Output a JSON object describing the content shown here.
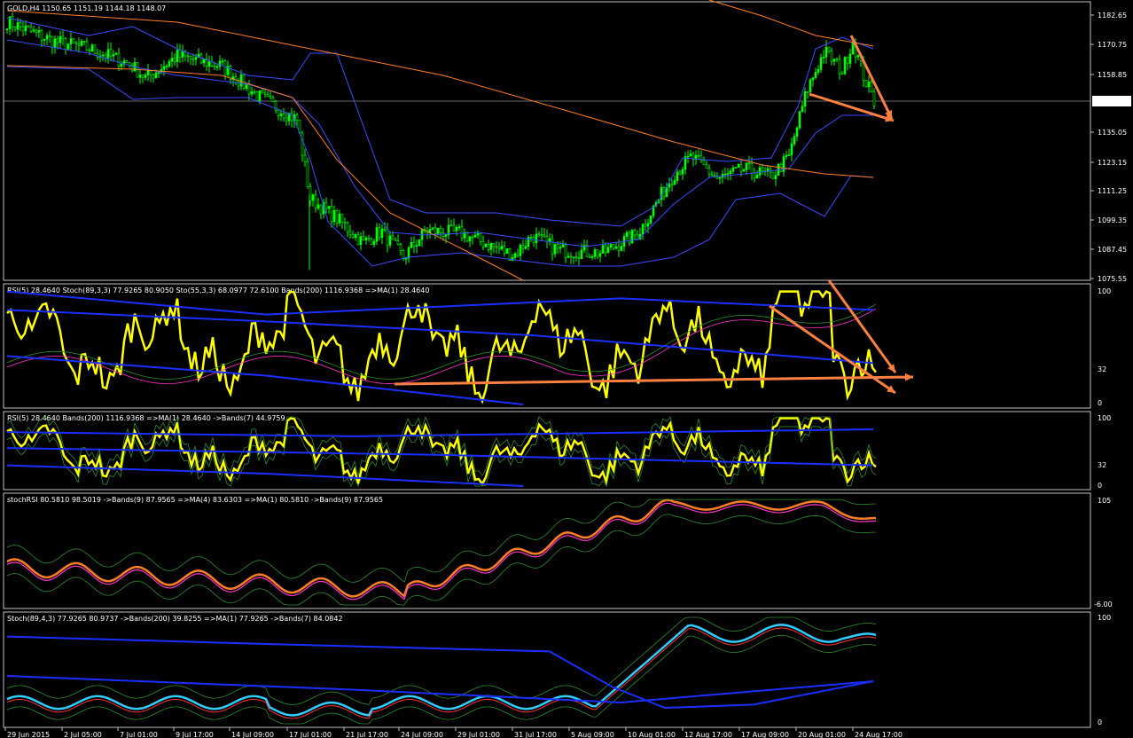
{
  "window": {
    "symbol_line": "GOLD,H4  1150.65 1151.19 1144.18 1148.07",
    "price_tag": "1148.07"
  },
  "colors": {
    "background": "#000000",
    "frame": "#c0c0c0",
    "bull_candle": "#00ff00",
    "bear_candle": "#00ff00",
    "bollinger": "#3a4dff",
    "ma_orange": "#ff7f27",
    "rsi": "#ffff00",
    "bands_blue": "#1a2fff",
    "green_band": "#2e8b2e",
    "pink": "#ff33cc",
    "cyan": "#33ccff",
    "arrow": "#ff8040"
  },
  "panels": [
    {
      "id": "price",
      "label": "GOLD,H4  1150.65 1151.19 1144.18 1148.07",
      "y_ticks": [
        "1182.65",
        "1170.75",
        "1158.85",
        "1148.07",
        "1135.05",
        "1123.15",
        "1111.25",
        "1099.35",
        "1087.45",
        "1075.55"
      ]
    },
    {
      "id": "rsi_stoch",
      "label": "RSI(5) 28.4640  Stoch(89,3,3) 77.9265 80.9050  Sto(55,3,3) 68.0977 72.6100  Bands(200) 1116.9368  =>MA(1) 28.4640",
      "y_ticks": [
        "100",
        "32",
        "0"
      ]
    },
    {
      "id": "rsi_bands",
      "label": "RSI(5) 28.4640  Bands(200) 1116.9368  =>MA(1) 28.4640  ->Bands(7) 44.9759",
      "y_ticks": [
        "100",
        "32",
        "0"
      ]
    },
    {
      "id": "stochrsi",
      "label": "stochRSI 80.5810 98.5019  ->Bands(9) 87.9565  =>MA(4) 83.6303  =>MA(1) 80.5810  ->Bands(9) 87.9565",
      "y_ticks": [
        "105",
        "-6.00"
      ]
    },
    {
      "id": "stoch",
      "label": "Stoch(89,4,3) 77.9265 80.9737  ->Bands(200) 39.8255  =>MA(1) 77.9265  ->Bands(7) 84.0842",
      "y_ticks": [
        "100",
        "0"
      ]
    }
  ],
  "x_labels": [
    "29 Jun 2015",
    "2 Jul 05:00",
    "7 Jul 01:00",
    "9 Jul 17:00",
    "14 Jul 09:00",
    "17 Jul 01:00",
    "21 Jul 17:00",
    "24 Jul 09:00",
    "29 Jul 01:00",
    "31 Jul 17:00",
    "5 Aug 09:00",
    "10 Aug 01:00",
    "12 Aug 17:00",
    "17 Aug 09:00",
    "20 Aug 01:00",
    "24 Aug 17:00"
  ],
  "chart_data": {
    "type": "line",
    "title": "GOLD,H4",
    "ohlc_last": {
      "open": 1150.65,
      "high": 1151.19,
      "low": 1144.18,
      "close": 1148.07
    },
    "ylim": [
      1075.55,
      1182.65
    ],
    "categories": [
      "29 Jun 2015",
      "2 Jul 05:00",
      "7 Jul 01:00",
      "9 Jul 17:00",
      "14 Jul 09:00",
      "17 Jul 01:00",
      "21 Jul 17:00",
      "24 Jul 09:00",
      "29 Jul 01:00",
      "31 Jul 17:00",
      "5 Aug 09:00",
      "10 Aug 01:00",
      "12 Aug 17:00",
      "17 Aug 09:00",
      "20 Aug 01:00",
      "24 Aug 17:00"
    ],
    "series": [
      {
        "name": "GOLD,H4",
        "values": [
          1180,
          1171,
          1161,
          1167,
          1162,
          1140,
          1099,
          1086,
          1094,
          1090,
          1088,
          1110,
          1125,
          1119,
          1165,
          1148
        ]
      },
      {
        "name": "RSI(5)",
        "values": [
          60,
          45,
          70,
          55,
          50,
          20,
          40,
          75,
          55,
          70,
          45,
          65,
          80,
          45,
          95,
          28
        ]
      },
      {
        "name": "stochRSI",
        "values": [
          45,
          30,
          20,
          25,
          20,
          10,
          5,
          15,
          40,
          60,
          70,
          88,
          95,
          92,
          98,
          80
        ]
      },
      {
        "name": "Stoch(89,4,3)",
        "values": [
          20,
          25,
          15,
          20,
          15,
          10,
          12,
          15,
          12,
          10,
          8,
          60,
          85,
          80,
          95,
          78
        ]
      }
    ]
  }
}
